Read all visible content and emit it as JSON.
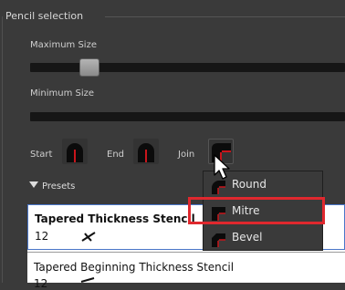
{
  "group": {
    "title": "Pencil selection"
  },
  "max_size": {
    "label": "Maximum Size",
    "value_fraction": 0.22
  },
  "min_size": {
    "label": "Minimum Size",
    "value_fraction": 0.0
  },
  "tips": {
    "start_label": "Start",
    "end_label": "End",
    "join_label": "Join",
    "start_icon": "round-tip-icon",
    "end_icon": "round-tip-icon",
    "join_icon": "mitre-join-icon"
  },
  "presets": {
    "label": "Presets"
  },
  "preset_list": [
    {
      "name": "Tapered Thickness Stencil",
      "value": "12",
      "selected": true
    },
    {
      "name": "Tapered Beginning Thickness Stencil",
      "value": "12",
      "selected": false
    }
  ],
  "join_menu": {
    "items": [
      {
        "label": "Round",
        "icon": "round-join-icon"
      },
      {
        "label": "Mitre",
        "icon": "mitre-join-icon",
        "highlighted": true
      },
      {
        "label": "Bevel",
        "icon": "bevel-join-icon"
      }
    ]
  },
  "colors": {
    "accent_red": "#e0282e",
    "tip_red": "#c8151b",
    "selection_border": "#4a76c9"
  }
}
